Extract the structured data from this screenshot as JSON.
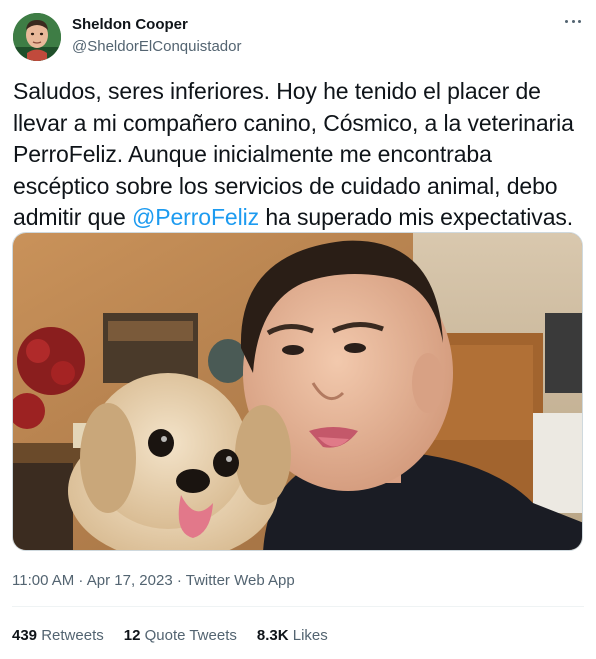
{
  "author": {
    "display_name": "Sheldon Cooper",
    "handle": "@SheldorElConquistador"
  },
  "tweet": {
    "text_part1": "Saludos, seres inferiores. Hoy he tenido el placer de\nllevar a mi compañero canino, Cósmico, a la veterinaria\nPerroFeliz. Aunque inicialmente me encontraba\nescéptico sobre los servicios de cuidado animal, debo\nadmitir que ",
    "mention": "@PerroFeliz",
    "text_part2": " ha superado mis expectativas."
  },
  "meta": {
    "time": "11:00 AM",
    "separator": " · ",
    "date": "Apr 17, 2023",
    "source": "Twitter Web App"
  },
  "stats": {
    "retweets_count": "439",
    "retweets_label": "Retweets",
    "quotes_count": "12",
    "quotes_label": "Quote Tweets",
    "likes_count": "8.3K",
    "likes_label": "Likes"
  },
  "icons": {
    "more": "more-horizontal-icon"
  },
  "colors": {
    "link": "#1d9bf0",
    "secondary_text": "#536471",
    "primary_text": "#0f1419",
    "divider": "#eff3f4"
  }
}
